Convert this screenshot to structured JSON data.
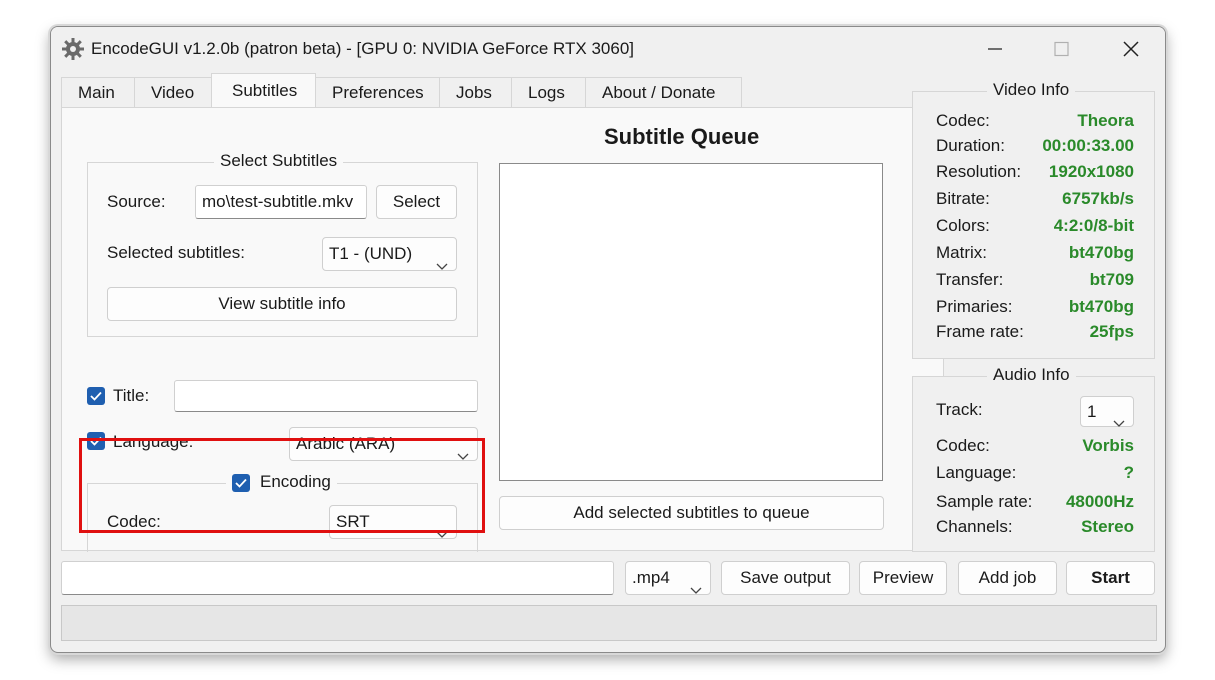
{
  "window": {
    "title": "EncodeGUI v1.2.0b (patron beta) - [GPU 0: NVIDIA GeForce RTX 3060]"
  },
  "tabs": [
    {
      "label": "Main"
    },
    {
      "label": "Video"
    },
    {
      "label": "Subtitles"
    },
    {
      "label": "Preferences"
    },
    {
      "label": "Jobs"
    },
    {
      "label": "Logs"
    },
    {
      "label": "About / Donate"
    }
  ],
  "active_tab": "Subtitles",
  "select_subtitles": {
    "group_title": "Select Subtitles",
    "source_label": "Source:",
    "source_value": "mo\\test-subtitle.mkv",
    "select_button": "Select",
    "selected_label": "Selected subtitles:",
    "selected_value": "T1 - (UND)",
    "view_info_button": "View subtitle info"
  },
  "title_field": {
    "label": "Title:",
    "checked": true,
    "value": ""
  },
  "language_field": {
    "label": "Language:",
    "checked": true,
    "value": "Arabic (ARA)"
  },
  "encoding": {
    "group_title": "Encoding",
    "checked": true,
    "codec_label": "Codec:",
    "codec_value": "SRT"
  },
  "queue": {
    "title": "Subtitle Queue",
    "add_button": "Add selected subtitles to queue"
  },
  "video_info": {
    "title": "Video Info",
    "rows": [
      {
        "key": "Codec:",
        "value": "Theora"
      },
      {
        "key": "Duration:",
        "value": "00:00:33.00"
      },
      {
        "key": "Resolution:",
        "value": "1920x1080"
      },
      {
        "key": "Bitrate:",
        "value": "6757kb/s"
      },
      {
        "key": "Colors:",
        "value": "4:2:0/8-bit"
      },
      {
        "key": "Matrix:",
        "value": "bt470bg"
      },
      {
        "key": "Transfer:",
        "value": "bt709"
      },
      {
        "key": "Primaries:",
        "value": "bt470bg"
      },
      {
        "key": "Frame rate:",
        "value": "25fps"
      }
    ]
  },
  "audio_info": {
    "title": "Audio Info",
    "track_label": "Track:",
    "track_value": "1",
    "rows": [
      {
        "key": "Codec:",
        "value": "Vorbis"
      },
      {
        "key": "Language:",
        "value": "?"
      },
      {
        "key": "Sample rate:",
        "value": "48000Hz"
      },
      {
        "key": "Channels:",
        "value": "Stereo"
      }
    ]
  },
  "bottom": {
    "output_path": "",
    "container_value": ".mp4",
    "save_output": "Save output",
    "preview": "Preview",
    "add_job": "Add job",
    "start": "Start"
  },
  "colors": {
    "info_value": "#2a8a2a",
    "checkbox": "#1f5fb0",
    "highlight": "#e01010"
  }
}
